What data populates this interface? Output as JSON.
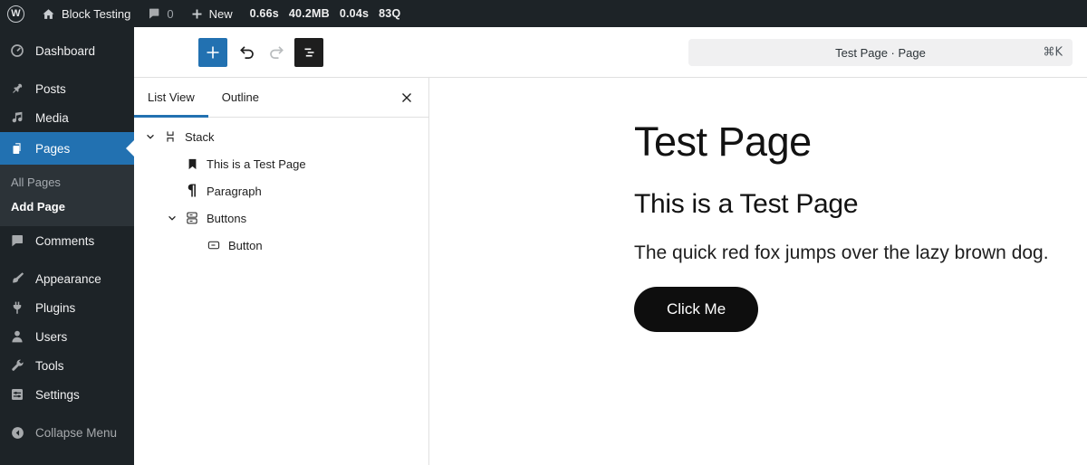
{
  "admin_bar": {
    "site_name": "Block Testing",
    "comment_count": "0",
    "new_label": "New",
    "stats": [
      "0.66s",
      "40.2MB",
      "0.04s",
      "83Q"
    ]
  },
  "sidebar": {
    "items": [
      {
        "label": "Dashboard"
      },
      {
        "label": "Posts"
      },
      {
        "label": "Media"
      },
      {
        "label": "Pages",
        "active": true
      },
      {
        "label": "Comments"
      },
      {
        "label": "Appearance"
      },
      {
        "label": "Plugins"
      },
      {
        "label": "Users"
      },
      {
        "label": "Tools"
      },
      {
        "label": "Settings"
      },
      {
        "label": "Collapse Menu"
      }
    ],
    "pages_submenu": [
      "All Pages",
      "Add Page"
    ],
    "current_submenu_item": "Add Page"
  },
  "editor_header": {
    "command_title": "Test Page · Page",
    "command_shortcut": "⌘K"
  },
  "list_view": {
    "tabs": [
      {
        "label": "List View",
        "active": true
      },
      {
        "label": "Outline",
        "active": false
      }
    ],
    "tree": [
      {
        "label": "Stack",
        "block": "stack",
        "level": 1,
        "expanded": true
      },
      {
        "label": "This is a Test Page",
        "block": "heading",
        "level": 2
      },
      {
        "label": "Paragraph",
        "block": "paragraph",
        "level": 2
      },
      {
        "label": "Buttons",
        "block": "buttons",
        "level": 2,
        "expanded": true
      },
      {
        "label": "Button",
        "block": "button",
        "level": 3
      }
    ]
  },
  "canvas": {
    "title": "Test Page",
    "heading": "This is a Test Page",
    "paragraph": "The quick red fox jumps over the lazy brown dog.",
    "button_label": "Click Me"
  },
  "colors": {
    "accent_blue": "#2271b1",
    "admin_dark": "#1d2327",
    "submenu_dark": "#2c3338",
    "canvas_button": "#0e0e0e",
    "border": "#e0e0e0"
  }
}
